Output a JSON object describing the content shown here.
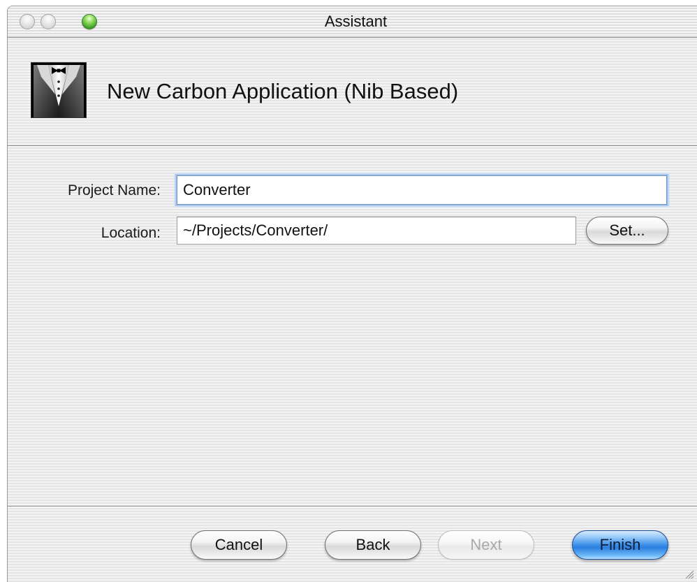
{
  "window": {
    "title": "Assistant"
  },
  "header": {
    "heading": "New Carbon Application (Nib Based)",
    "icon": "tuxedo-icon"
  },
  "form": {
    "project_name_label": "Project Name:",
    "project_name_value": "Converter",
    "location_label": "Location:",
    "location_value": "~/Projects/Converter/",
    "set_button_label": "Set..."
  },
  "footer": {
    "cancel_label": "Cancel",
    "back_label": "Back",
    "next_label": "Next",
    "finish_label": "Finish"
  },
  "colors": {
    "focus_ring": "#a9c6ea",
    "default_button": "#3b8ee6",
    "close_minimize_buttons": "#d0d0d0",
    "zoom_button": "#3aa12a"
  }
}
